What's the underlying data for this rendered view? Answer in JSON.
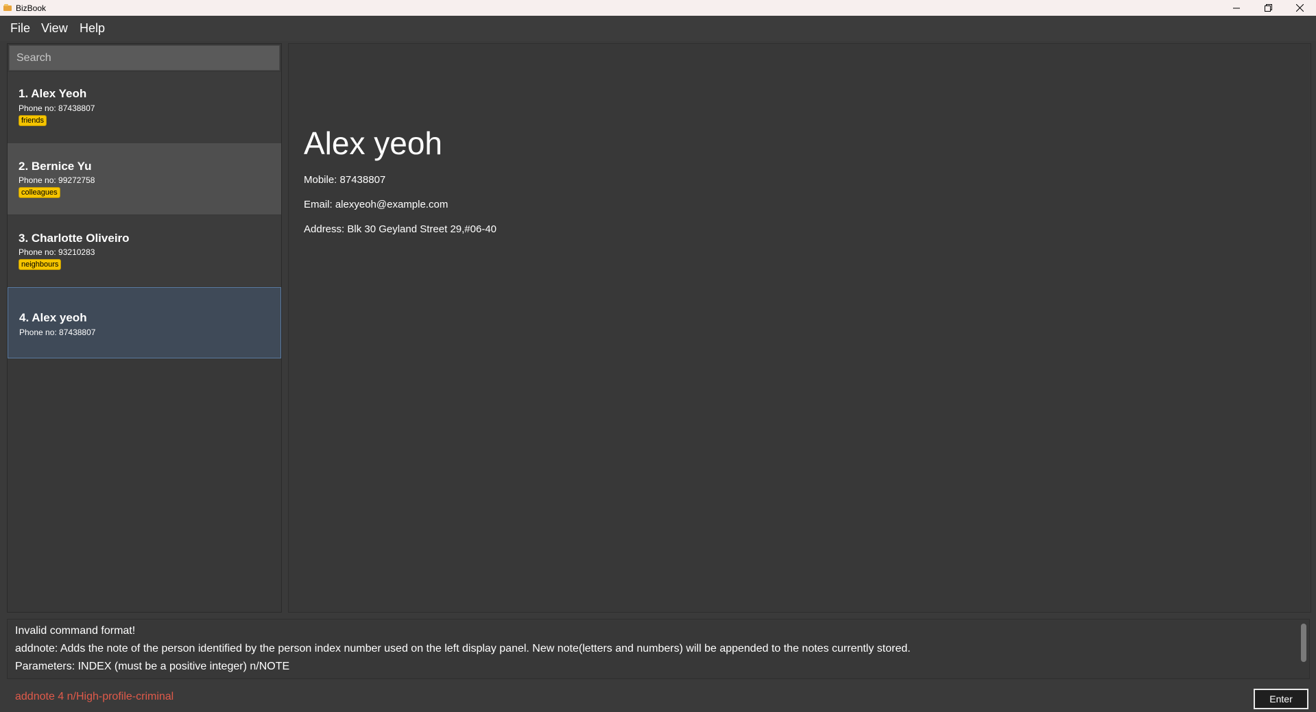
{
  "window": {
    "title": "BizBook"
  },
  "menu": {
    "items": [
      "File",
      "View",
      "Help"
    ]
  },
  "search": {
    "placeholder": "Search"
  },
  "persons": [
    {
      "index_name": "1. Alex Yeoh",
      "phone": "Phone no: 87438807",
      "tag": "friends"
    },
    {
      "index_name": "2. Bernice Yu",
      "phone": "Phone no: 99272758",
      "tag": "colleagues"
    },
    {
      "index_name": "3. Charlotte Oliveiro",
      "phone": "Phone no: 93210283",
      "tag": "neighbours"
    },
    {
      "index_name": "4. Alex yeoh",
      "phone": "Phone no: 87438807"
    }
  ],
  "detail": {
    "name": "Alex yeoh",
    "mobile": "Mobile: 87438807",
    "email": "Email: alexyeoh@example.com",
    "address": "Address: Blk 30 Geyland Street 29,#06-40"
  },
  "result": {
    "lines": [
      "Invalid command format!",
      "addnote: Adds the note of the person identified by the person index number used on the left display panel. New note(letters and numbers) will be appended to the notes currently stored.",
      "Parameters: INDEX (must be a positive integer) n/NOTE"
    ]
  },
  "command": {
    "value": "addnote 4 n/High-profile-criminal",
    "enter_label": "Enter"
  },
  "colors": {
    "tag_bg": "#f5c400",
    "selected_card": "#3f4a58",
    "hover_card": "#4f4f4f",
    "error_text": "#e05a4a"
  }
}
